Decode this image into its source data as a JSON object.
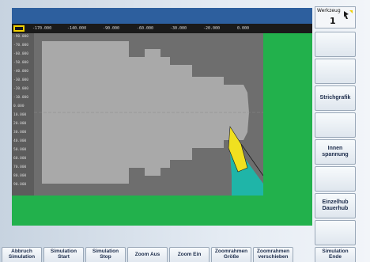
{
  "ruler_x": [
    "-170.000",
    "-140.000",
    "-90.000",
    "-60.000",
    "-30.000",
    "-20.000",
    "0.000"
  ],
  "ruler_y": [
    "-90.000",
    "-70.000",
    "-60.000",
    "-50.000",
    "-40.000",
    "-30.000",
    "-20.000",
    "-10.000",
    "0.000",
    "10.000",
    "20.000",
    "30.000",
    "40.000",
    "50.000",
    "60.000",
    "70.000",
    "80.000",
    "90.000"
  ],
  "tool": {
    "label": "Werkzeug",
    "number": "1"
  },
  "softkeys_right": [
    {
      "label": ""
    },
    {
      "label": ""
    },
    {
      "label": "Strichgrafik"
    },
    {
      "label": ""
    },
    {
      "label": "Innen\nspannung"
    },
    {
      "label": ""
    },
    {
      "label": "Einzelhub\nDauerhub"
    },
    {
      "label": ""
    }
  ],
  "softkeys_bottom": [
    {
      "label": "Abbruch\nSimulation"
    },
    {
      "label": "Simulation\nStart"
    },
    {
      "label": "Simulation\nStop"
    },
    {
      "label": "Zoom Aus"
    },
    {
      "label": "Zoom Ein"
    },
    {
      "label": "Zoomrahmen\nGröße"
    },
    {
      "label": "Zoomrahmen\nverschieben"
    },
    {
      "label": "Simulation\nEnde"
    }
  ],
  "colors": {
    "background_green": "#22b14c",
    "workpiece": "#a9a9a9",
    "chuck_area": "#6e6e6e",
    "tool_insert": "#f0e020",
    "tool_holder": "#1fb5a8"
  }
}
